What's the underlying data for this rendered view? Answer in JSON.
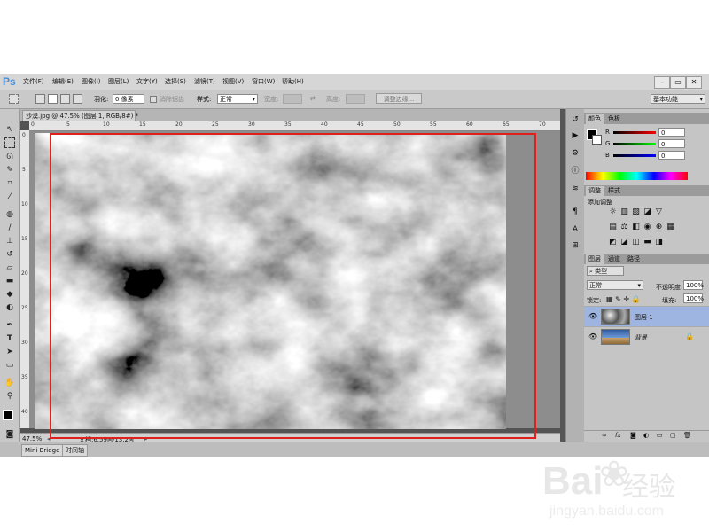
{
  "app": {
    "logo": "Ps"
  },
  "menu": [
    "文件(F)",
    "编辑(E)",
    "图像(I)",
    "图层(L)",
    "文字(Y)",
    "选择(S)",
    "滤镜(T)",
    "视图(V)",
    "窗口(W)",
    "帮助(H)"
  ],
  "window_buttons": [
    "–",
    "▭",
    "✕"
  ],
  "options": {
    "feather_label": "羽化:",
    "feather_value": "0 像素",
    "antialias_label": "消除锯齿",
    "style_label": "样式:",
    "style_value": "正常",
    "width_label": "宽度:",
    "height_label": "高度:",
    "refine_edge_button": "调整边缘...",
    "workspace": "基本功能"
  },
  "document": {
    "tab_title": "沙漠.jpg @ 47.5% (图层 1, RGB/8#) *",
    "zoom": "47.5%",
    "doc_info": "文档:6.59M/13.2M",
    "ruler_h": [
      "0",
      "5",
      "10",
      "15",
      "20",
      "25",
      "30",
      "35",
      "40",
      "45",
      "50",
      "55",
      "60",
      "65",
      "70"
    ],
    "ruler_v": [
      "0",
      "5",
      "10",
      "15",
      "20",
      "25",
      "30",
      "35",
      "40"
    ]
  },
  "bottom_tabs": [
    "Mini Bridge",
    "时间轴"
  ],
  "color_panel": {
    "tabs": [
      "颜色",
      "色板"
    ],
    "channels": [
      {
        "label": "R",
        "value": "0"
      },
      {
        "label": "G",
        "value": "0"
      },
      {
        "label": "B",
        "value": "0"
      }
    ]
  },
  "adjust_panel": {
    "tabs": [
      "调整",
      "样式"
    ],
    "title": "添加调整"
  },
  "layers_panel": {
    "tabs": [
      "图层",
      "通道",
      "路径"
    ],
    "kind_label": "类型",
    "blend_mode": "正常",
    "opacity_label": "不透明度:",
    "opacity_value": "100%",
    "lock_label": "锁定:",
    "fill_label": "填充:",
    "fill_value": "100%",
    "layers": [
      {
        "name": "图层 1",
        "selected": true
      },
      {
        "name": "背景",
        "selected": false
      }
    ]
  },
  "watermark": {
    "brand": "Bai",
    "brand2": "经验",
    "url": "jingyan.baidu.com"
  },
  "colors": {
    "accent_red": "#e0201c",
    "selected_layer": "#9db5e0",
    "ps_blue": "#4a8fd6"
  }
}
